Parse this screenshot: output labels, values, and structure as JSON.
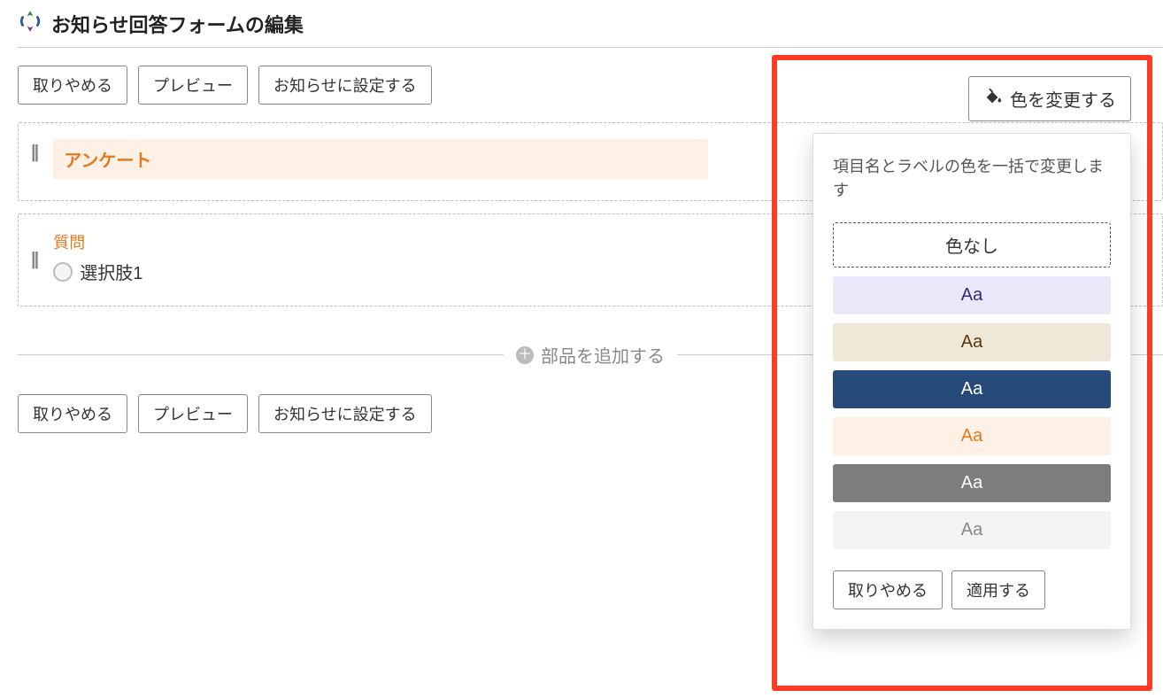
{
  "page_title": "お知らせ回答フォームの編集",
  "top_buttons": {
    "cancel": "取りやめる",
    "preview": "プレビュー",
    "apply_notice": "お知らせに設定する"
  },
  "form_items": {
    "survey_label": "アンケート",
    "question_label": "質問",
    "option1_label": "選択肢1"
  },
  "add_component_label": "部品を追加する",
  "color_change_button": "色を変更する",
  "popover": {
    "title": "項目名とラベルの色を一括で変更します",
    "swatch_none": "色なし",
    "swatch_aa": "Aa",
    "cancel": "取りやめる",
    "apply": "適用する"
  }
}
